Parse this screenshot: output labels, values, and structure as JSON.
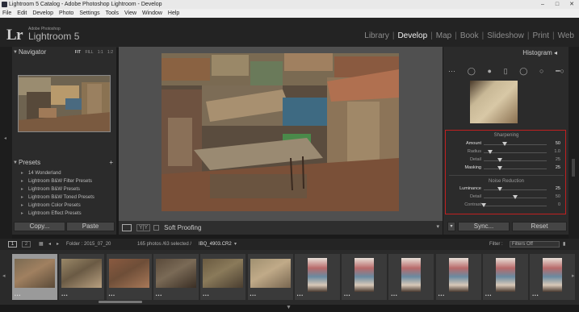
{
  "window": {
    "title": "Lightroom 5 Catalog - Adobe Photoshop Lightroom - Develop",
    "controls": [
      "–",
      "□",
      "✕"
    ]
  },
  "menubar": [
    "File",
    "Edit",
    "Develop",
    "Photo",
    "Settings",
    "Tools",
    "View",
    "Window",
    "Help"
  ],
  "brand": {
    "logo": "Lr",
    "line1": "Adobe Photoshop",
    "line2": "Lightroom 5"
  },
  "modules": [
    {
      "label": "Library",
      "active": false
    },
    {
      "label": "Develop",
      "active": true
    },
    {
      "label": "Map",
      "active": false
    },
    {
      "label": "Book",
      "active": false
    },
    {
      "label": "Slideshow",
      "active": false
    },
    {
      "label": "Print",
      "active": false
    },
    {
      "label": "Web",
      "active": false
    }
  ],
  "left": {
    "navigator_title": "Navigator",
    "navigator_options": [
      "FIT",
      "FILL",
      "1:1",
      "1:2"
    ],
    "presets_title": "Presets",
    "presets_add": "+",
    "presets": [
      "14 Wonderland",
      "Lightroom B&W Filter Presets",
      "Lightroom B&W Presets",
      "Lightroom B&W Toned Presets",
      "Lightroom Color Presets",
      "Lightroom Effect Presets"
    ],
    "copy_label": "Copy...",
    "paste_label": "Paste"
  },
  "toolbar": {
    "yy_label": "Y|Y",
    "soft_proofing_label": "Soft Proofing"
  },
  "right": {
    "histogram_title": "Histogram",
    "tool_icons": [
      "grid-icon",
      "crop-icon",
      "spot-removal-icon",
      "red-eye-icon",
      "graduated-filter-icon",
      "radial-filter-icon",
      "adjustment-brush-icon"
    ],
    "sharpening": {
      "title": "Sharpening",
      "rows": [
        {
          "label": "Amount",
          "value": "50",
          "level": 0.33,
          "bright": true
        },
        {
          "label": "Radius",
          "value": "1.0",
          "level": 0.1,
          "bright": false
        },
        {
          "label": "Detail",
          "value": "25",
          "level": 0.25,
          "bright": false
        },
        {
          "label": "Masking",
          "value": "25",
          "level": 0.25,
          "bright": true
        }
      ]
    },
    "noise_reduction": {
      "title": "Noise Reduction",
      "rows": [
        {
          "label": "Luminance",
          "value": "25",
          "level": 0.25,
          "bright": true
        },
        {
          "label": "Detail",
          "value": "50",
          "level": 0.5,
          "bright": false
        },
        {
          "label": "Contrast",
          "value": "0",
          "level": 0.0,
          "bright": false
        }
      ]
    },
    "sync_label": "Sync...",
    "reset_label": "Reset"
  },
  "filmstrip_bar": {
    "page1": "1",
    "page2": "2",
    "folder": "Folder : 2015_07_20",
    "count": "165 photos /63 selected /",
    "filename": "IBQ_4903.CR2",
    "filter_label": "Filter :",
    "filter_value": "Filters Off"
  },
  "filmstrip": [
    {
      "selected": true,
      "portrait": false,
      "rating": "•••"
    },
    {
      "selected": false,
      "portrait": false,
      "rating": "•••"
    },
    {
      "selected": false,
      "portrait": false,
      "rating": "•••"
    },
    {
      "selected": false,
      "portrait": false,
      "rating": "•••"
    },
    {
      "selected": false,
      "portrait": false,
      "rating": "•••"
    },
    {
      "selected": false,
      "portrait": false,
      "rating": "•••"
    },
    {
      "selected": false,
      "portrait": true,
      "rating": "•••"
    },
    {
      "selected": false,
      "portrait": true,
      "rating": "•••"
    },
    {
      "selected": false,
      "portrait": true,
      "rating": "•••"
    },
    {
      "selected": false,
      "portrait": true,
      "rating": "•••"
    },
    {
      "selected": false,
      "portrait": true,
      "rating": "•••"
    },
    {
      "selected": false,
      "portrait": true,
      "rating": "•••"
    }
  ],
  "colors": {
    "highlight_box": "#c02020",
    "active_module": "#f0f0f0"
  }
}
